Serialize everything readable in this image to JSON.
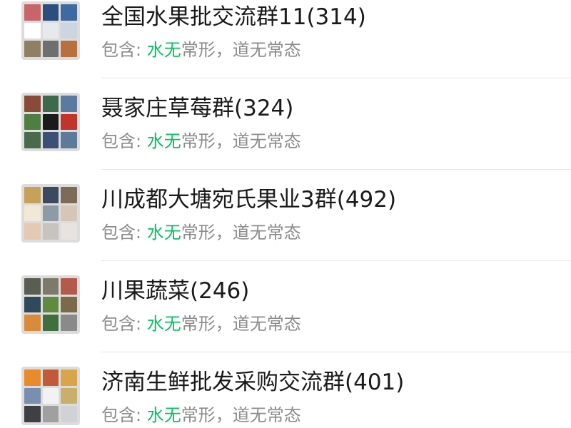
{
  "groups": [
    {
      "title": "全国水果批交流群11(314)",
      "contains_label": "包含: ",
      "match": "水无",
      "rest": "常形，道无常态",
      "tiles": [
        "#c9656a",
        "#2c4e7e",
        "#3f6aa1",
        "#ffffff",
        "#e7e9ec",
        "#ccd6e0",
        "#8f8063",
        "#6f6f6f",
        "#b8703f"
      ]
    },
    {
      "title": "聂家庄草莓群(324)",
      "contains_label": "包含: ",
      "match": "水无",
      "rest": "常形，道无常态",
      "tiles": [
        "#8a4a3a",
        "#3d6a4a",
        "#5a7aa0",
        "#4f7e43",
        "#1b1b1b",
        "#c0342c",
        "#4a6a4e",
        "#3c4f76",
        "#5c7a9a"
      ]
    },
    {
      "title": "川成都大塘宛氏果业3群(492)",
      "contains_label": "包含: ",
      "match": "水无",
      "rest": "常形，道无常态",
      "tiles": [
        "#c7a05a",
        "#3b4a5f",
        "#7d6a57",
        "#f2e8d8",
        "#8e9aa6",
        "#d7c6b8",
        "#e6c9b5",
        "#c9c3c0",
        "#e9e3df"
      ]
    },
    {
      "title": "川果蔬菜(246)",
      "contains_label": "包含: ",
      "match": "水无",
      "rest": "常形，道无常态",
      "tiles": [
        "#5a5d52",
        "#7d7a6a",
        "#b45a4a",
        "#2f4a5a",
        "#5f8a3f",
        "#7a6a4a",
        "#d98a3a",
        "#3f6f3f",
        "#8a8a8a"
      ]
    },
    {
      "title": "济南生鲜批发采购交流群(401)",
      "contains_label": "包含: ",
      "match": "水无",
      "rest": "常形，道无常态",
      "tiles": [
        "#e98b2a",
        "#c25a3a",
        "#d9a54a",
        "#7a8fb0",
        "#f2f2f2",
        "#c8b06a",
        "#3f3f44",
        "#a0a0a0",
        "#cfd3d8"
      ]
    }
  ]
}
